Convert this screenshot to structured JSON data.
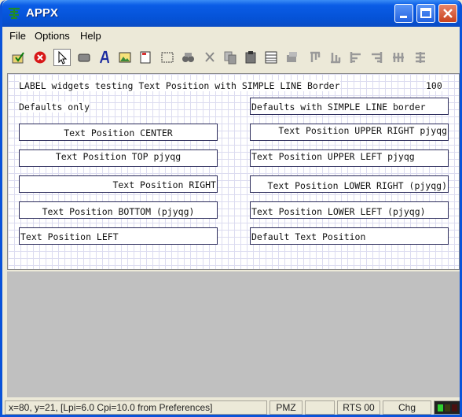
{
  "window": {
    "title": "APPX"
  },
  "menu": {
    "items": [
      "File",
      "Options",
      "Help"
    ]
  },
  "toolbar": {
    "tools": [
      "edit-check-icon",
      "cancel-icon",
      "pointer-icon",
      "button-icon",
      "text-icon",
      "picture-icon",
      "page-icon",
      "box-icon",
      "binoculars-icon",
      "cut-icon",
      "copy-icon",
      "paste-icon",
      "table-icon",
      "align-1-icon",
      "align-2-icon",
      "align-3-icon",
      "align-4-icon",
      "align-5-icon",
      "align-6-icon",
      "align-7-icon"
    ]
  },
  "canvas": {
    "header": "LABEL widgets testing Text Position with SIMPLE LINE Border",
    "header_number": "100",
    "left_title": "Defaults only",
    "right_title": "Defaults with SIMPLE LINE border",
    "left_labels": [
      "Text Position CENTER",
      "Text Position TOP pjyqg",
      "Text Position RIGHT",
      "Text Position BOTTOM (pjyqg)",
      "Text Position LEFT"
    ],
    "right_labels": [
      "Text Position UPPER RIGHT pjyqg",
      "Text Position UPPER LEFT pjyqg",
      "Text Position LOWER RIGHT (pjyqg)",
      "Text Position LOWER LEFT (pjyqg)",
      "Default Text Position"
    ]
  },
  "status": {
    "position": "x=80, y=21, [Lpi=6.0 Cpi=10.0 from Preferences]",
    "mode": "PMZ",
    "blank": "",
    "rts": "RTS 00",
    "chg": "Chg"
  },
  "colors": {
    "titlebar": "#0552D6",
    "border_blue": "#0A53D9",
    "close_red": "#C9421E"
  }
}
